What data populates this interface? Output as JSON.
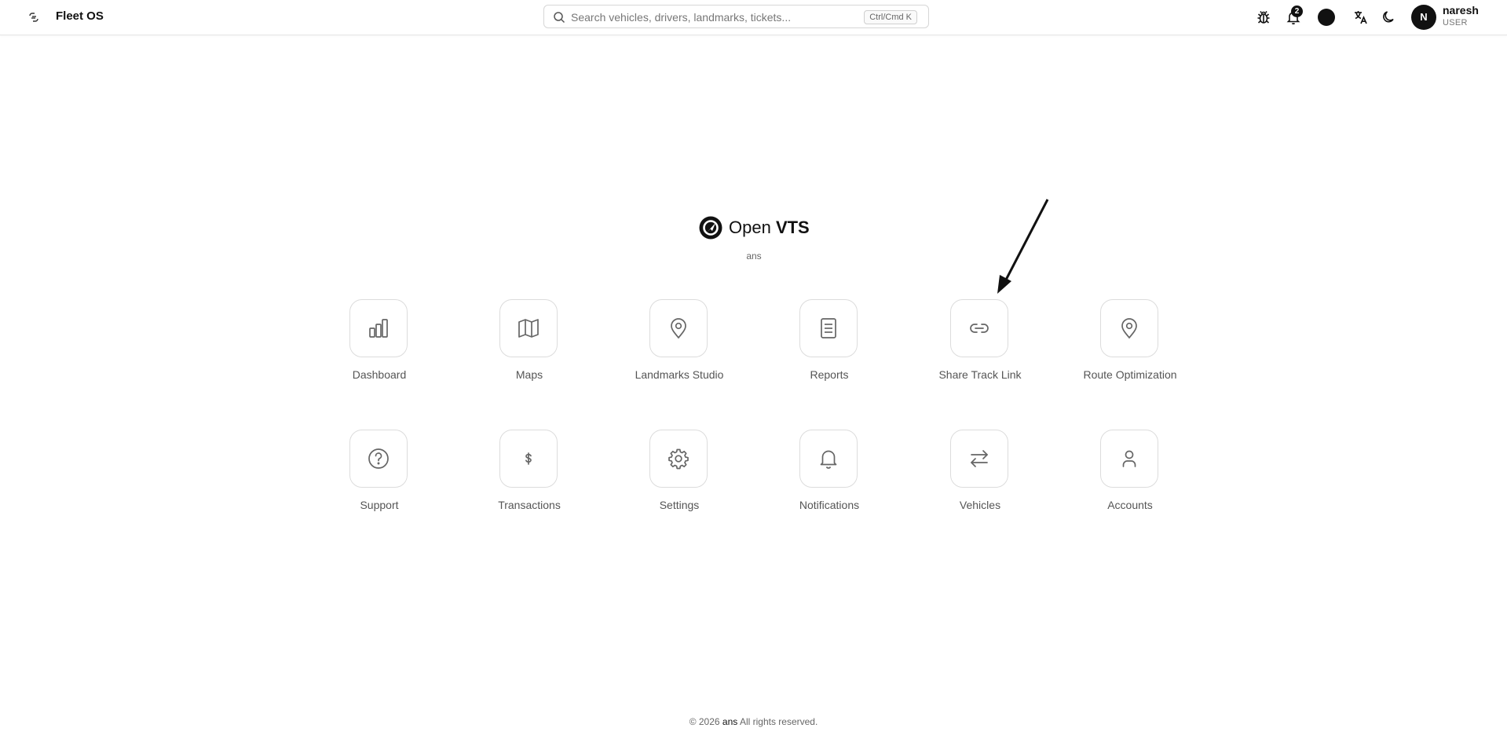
{
  "header": {
    "app_title": "Fleet OS",
    "search_placeholder": "Search vehicles, drivers, landmarks, tickets...",
    "search_shortcut": "Ctrl/Cmd K",
    "notification_count": "2",
    "user_name": "naresh",
    "user_role": "USER",
    "avatar_initial": "N",
    "icons": [
      "sidebar-toggle-icon",
      "search-icon",
      "bug-icon",
      "bell-icon",
      "theme-dot",
      "translate-icon",
      "moon-icon"
    ]
  },
  "brand": {
    "name_light": "Open ",
    "name_bold": "VTS",
    "subtitle": "ans"
  },
  "apps": [
    {
      "label": "Dashboard",
      "icon": "bar-chart-icon"
    },
    {
      "label": "Maps",
      "icon": "map-icon"
    },
    {
      "label": "Landmarks Studio",
      "icon": "map-pin-icon"
    },
    {
      "label": "Reports",
      "icon": "document-icon"
    },
    {
      "label": "Share Track Link",
      "icon": "link-icon"
    },
    {
      "label": "Route Optimization",
      "icon": "map-pin-icon"
    },
    {
      "label": "Support",
      "icon": "help-circle-icon"
    },
    {
      "label": "Transactions",
      "icon": "dollar-icon"
    },
    {
      "label": "Settings",
      "icon": "gear-icon"
    },
    {
      "label": "Notifications",
      "icon": "bell-icon"
    },
    {
      "label": "Vehicles",
      "icon": "swap-arrows-icon"
    },
    {
      "label": "Accounts",
      "icon": "user-icon"
    }
  ],
  "footer": {
    "prefix": "© 2026 ",
    "org": "ans",
    "suffix": " All rights reserved."
  },
  "colors": {
    "tile_border": "#dcdcdc",
    "icon_stroke": "#666666",
    "text_primary": "#111111"
  }
}
